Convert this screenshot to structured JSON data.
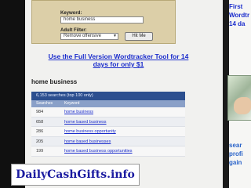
{
  "form": {
    "keyword_label": "Keyword:",
    "keyword_value": "home business",
    "adult_label": "Adult Filter:",
    "adult_value": "Remove offensive",
    "hit_button_label": "Hit Me"
  },
  "promo_link": "Use the Full Version Wordtracker Tool for 14 days for only $1",
  "results": {
    "title": "home business",
    "summary": "6,153 searches (top 100 only)",
    "col_searches": "Searches",
    "col_keyword": "Keyword",
    "rows": [
      {
        "count": "984",
        "keyword": "home business"
      },
      {
        "count": "658",
        "keyword": "home based business"
      },
      {
        "count": "286",
        "keyword": "home business opportunity"
      },
      {
        "count": "205",
        "keyword": "home based businesses"
      },
      {
        "count": "199",
        "keyword": "home based business opportunities"
      }
    ]
  },
  "right_ad": {
    "top_lines": [
      "First",
      "Wordtr",
      "14 da"
    ],
    "bottom_lines": [
      "sear",
      "profi",
      "gain"
    ]
  },
  "banner": "DailyCashGifts.info",
  "colors": {
    "link": "#1a2ccc",
    "table_header": "#2c4f8f",
    "form_bg": "#dccfa8",
    "banner_text": "#1a1aa0"
  }
}
